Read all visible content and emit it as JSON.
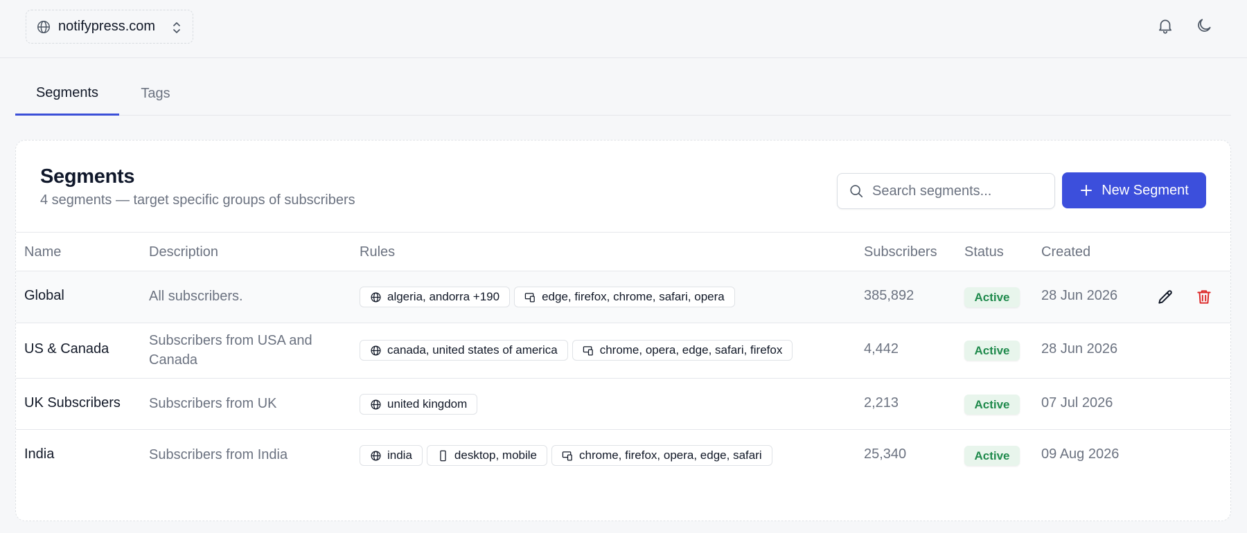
{
  "topbar": {
    "site_name": "notifypress.com",
    "icons": [
      "globe-icon",
      "chevron-up-down-icon",
      "bell-icon",
      "moon-icon"
    ]
  },
  "tabs": [
    {
      "label": "Segments",
      "active": true
    },
    {
      "label": "Tags",
      "active": false
    }
  ],
  "card": {
    "title": "Segments",
    "subtitle": "4 segments — target specific groups of subscribers",
    "search_placeholder": "Search segments...",
    "new_button_label": "New Segment"
  },
  "table": {
    "headers": {
      "name": "Name",
      "description": "Description",
      "rules": "Rules",
      "subscribers": "Subscribers",
      "status": "Status",
      "created": "Created"
    },
    "rows": [
      {
        "name": "Global",
        "description": "All subscribers.",
        "rules": [
          {
            "icon": "globe-icon",
            "text": "algeria, andorra +190"
          },
          {
            "icon": "browser-icon",
            "text": "edge, firefox, chrome, safari, opera"
          }
        ],
        "subscribers": "385,892",
        "status": "Active",
        "created": "28 Jun 2026"
      },
      {
        "name": "US & Canada",
        "description": "Subscribers from USA and Canada",
        "rules": [
          {
            "icon": "globe-icon",
            "text": "canada, united states of america"
          },
          {
            "icon": "browser-icon",
            "text": "chrome, opera, edge, safari, firefox"
          }
        ],
        "subscribers": "4,442",
        "status": "Active",
        "created": "28 Jun 2026"
      },
      {
        "name": "UK Subscribers",
        "description": "Subscribers from UK",
        "rules": [
          {
            "icon": "globe-icon",
            "text": "united kingdom"
          }
        ],
        "subscribers": "2,213",
        "status": "Active",
        "created": "07 Jul 2026"
      },
      {
        "name": "India",
        "description": "Subscribers from India",
        "rules": [
          {
            "icon": "globe-icon",
            "text": "india"
          },
          {
            "icon": "device-icon",
            "text": "desktop, mobile"
          },
          {
            "icon": "browser-icon",
            "text": "chrome, firefox, opera, edge, safari"
          }
        ],
        "subscribers": "25,340",
        "status": "Active",
        "created": "09 Aug 2026"
      }
    ]
  },
  "colors": {
    "accent": "#3c4fdc",
    "active_badge_bg": "#e8f5ec",
    "active_badge_text": "#1f8a4c",
    "delete": "#dc2626"
  }
}
